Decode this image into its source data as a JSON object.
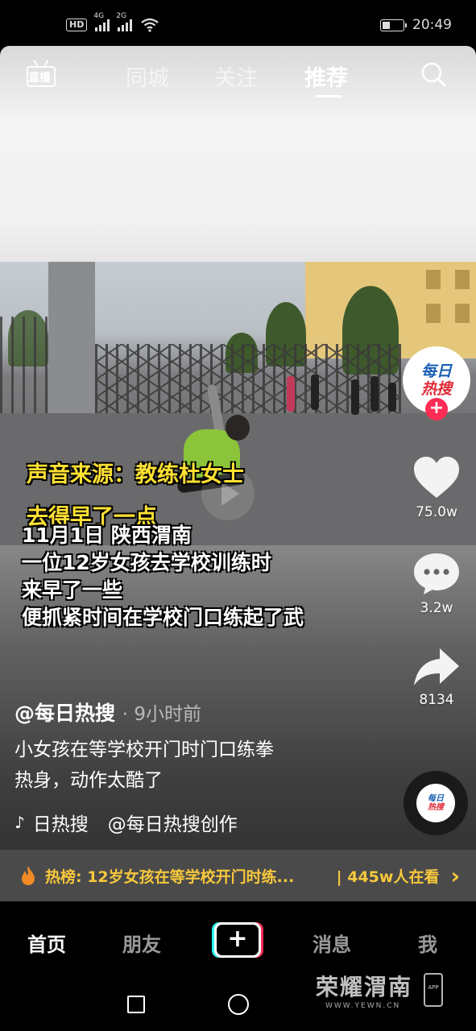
{
  "status_bar": {
    "hd": "HD",
    "net1": "4G",
    "net2": "2G",
    "time": "20:49"
  },
  "top_nav": {
    "live_label": "直播",
    "tabs": [
      {
        "label": "同城",
        "active": false
      },
      {
        "label": "关注",
        "active": false
      },
      {
        "label": "推荐",
        "active": true
      }
    ]
  },
  "video": {
    "caption_lines": [
      "声音来源：教练杜女士",
      "去得早了一点"
    ],
    "overlay_lines": [
      "11月1日 陕西渭南",
      "一位12岁女孩去学校训练时",
      "来早了一些",
      "便抓紧时间在学校门口练起了武"
    ]
  },
  "sidebar": {
    "avatar_line1": "每日",
    "avatar_line2": "热搜",
    "likes": "75.0w",
    "comments": "3.2w",
    "shares": "8134",
    "disc_line1": "每日",
    "disc_line2": "热搜"
  },
  "post": {
    "author": "@每日热搜",
    "time_ago": "· 9小时前",
    "description_line1": "小女孩在等学校开门时门口练拳",
    "description_line2": "热身，动作太酷了",
    "music_text1": "日热搜",
    "music_text2": "@每日热搜创作"
  },
  "hot_bar": {
    "text": "热榜: 12岁女孩在等学校开门时练...",
    "count": "| 445w人在看",
    "accent": "#f7c83c"
  },
  "bottom_tabs": {
    "home": "首页",
    "friends": "朋友",
    "create": "+",
    "messages": "消息",
    "me": "我"
  },
  "watermark": {
    "title": "荣耀渭南",
    "url": "WWW.YEWN.CN",
    "app": "APP"
  },
  "colors": {
    "accent_red": "#fe2c55",
    "accent_cyan": "#25f4ee",
    "caption_yellow": "#ffe033"
  }
}
